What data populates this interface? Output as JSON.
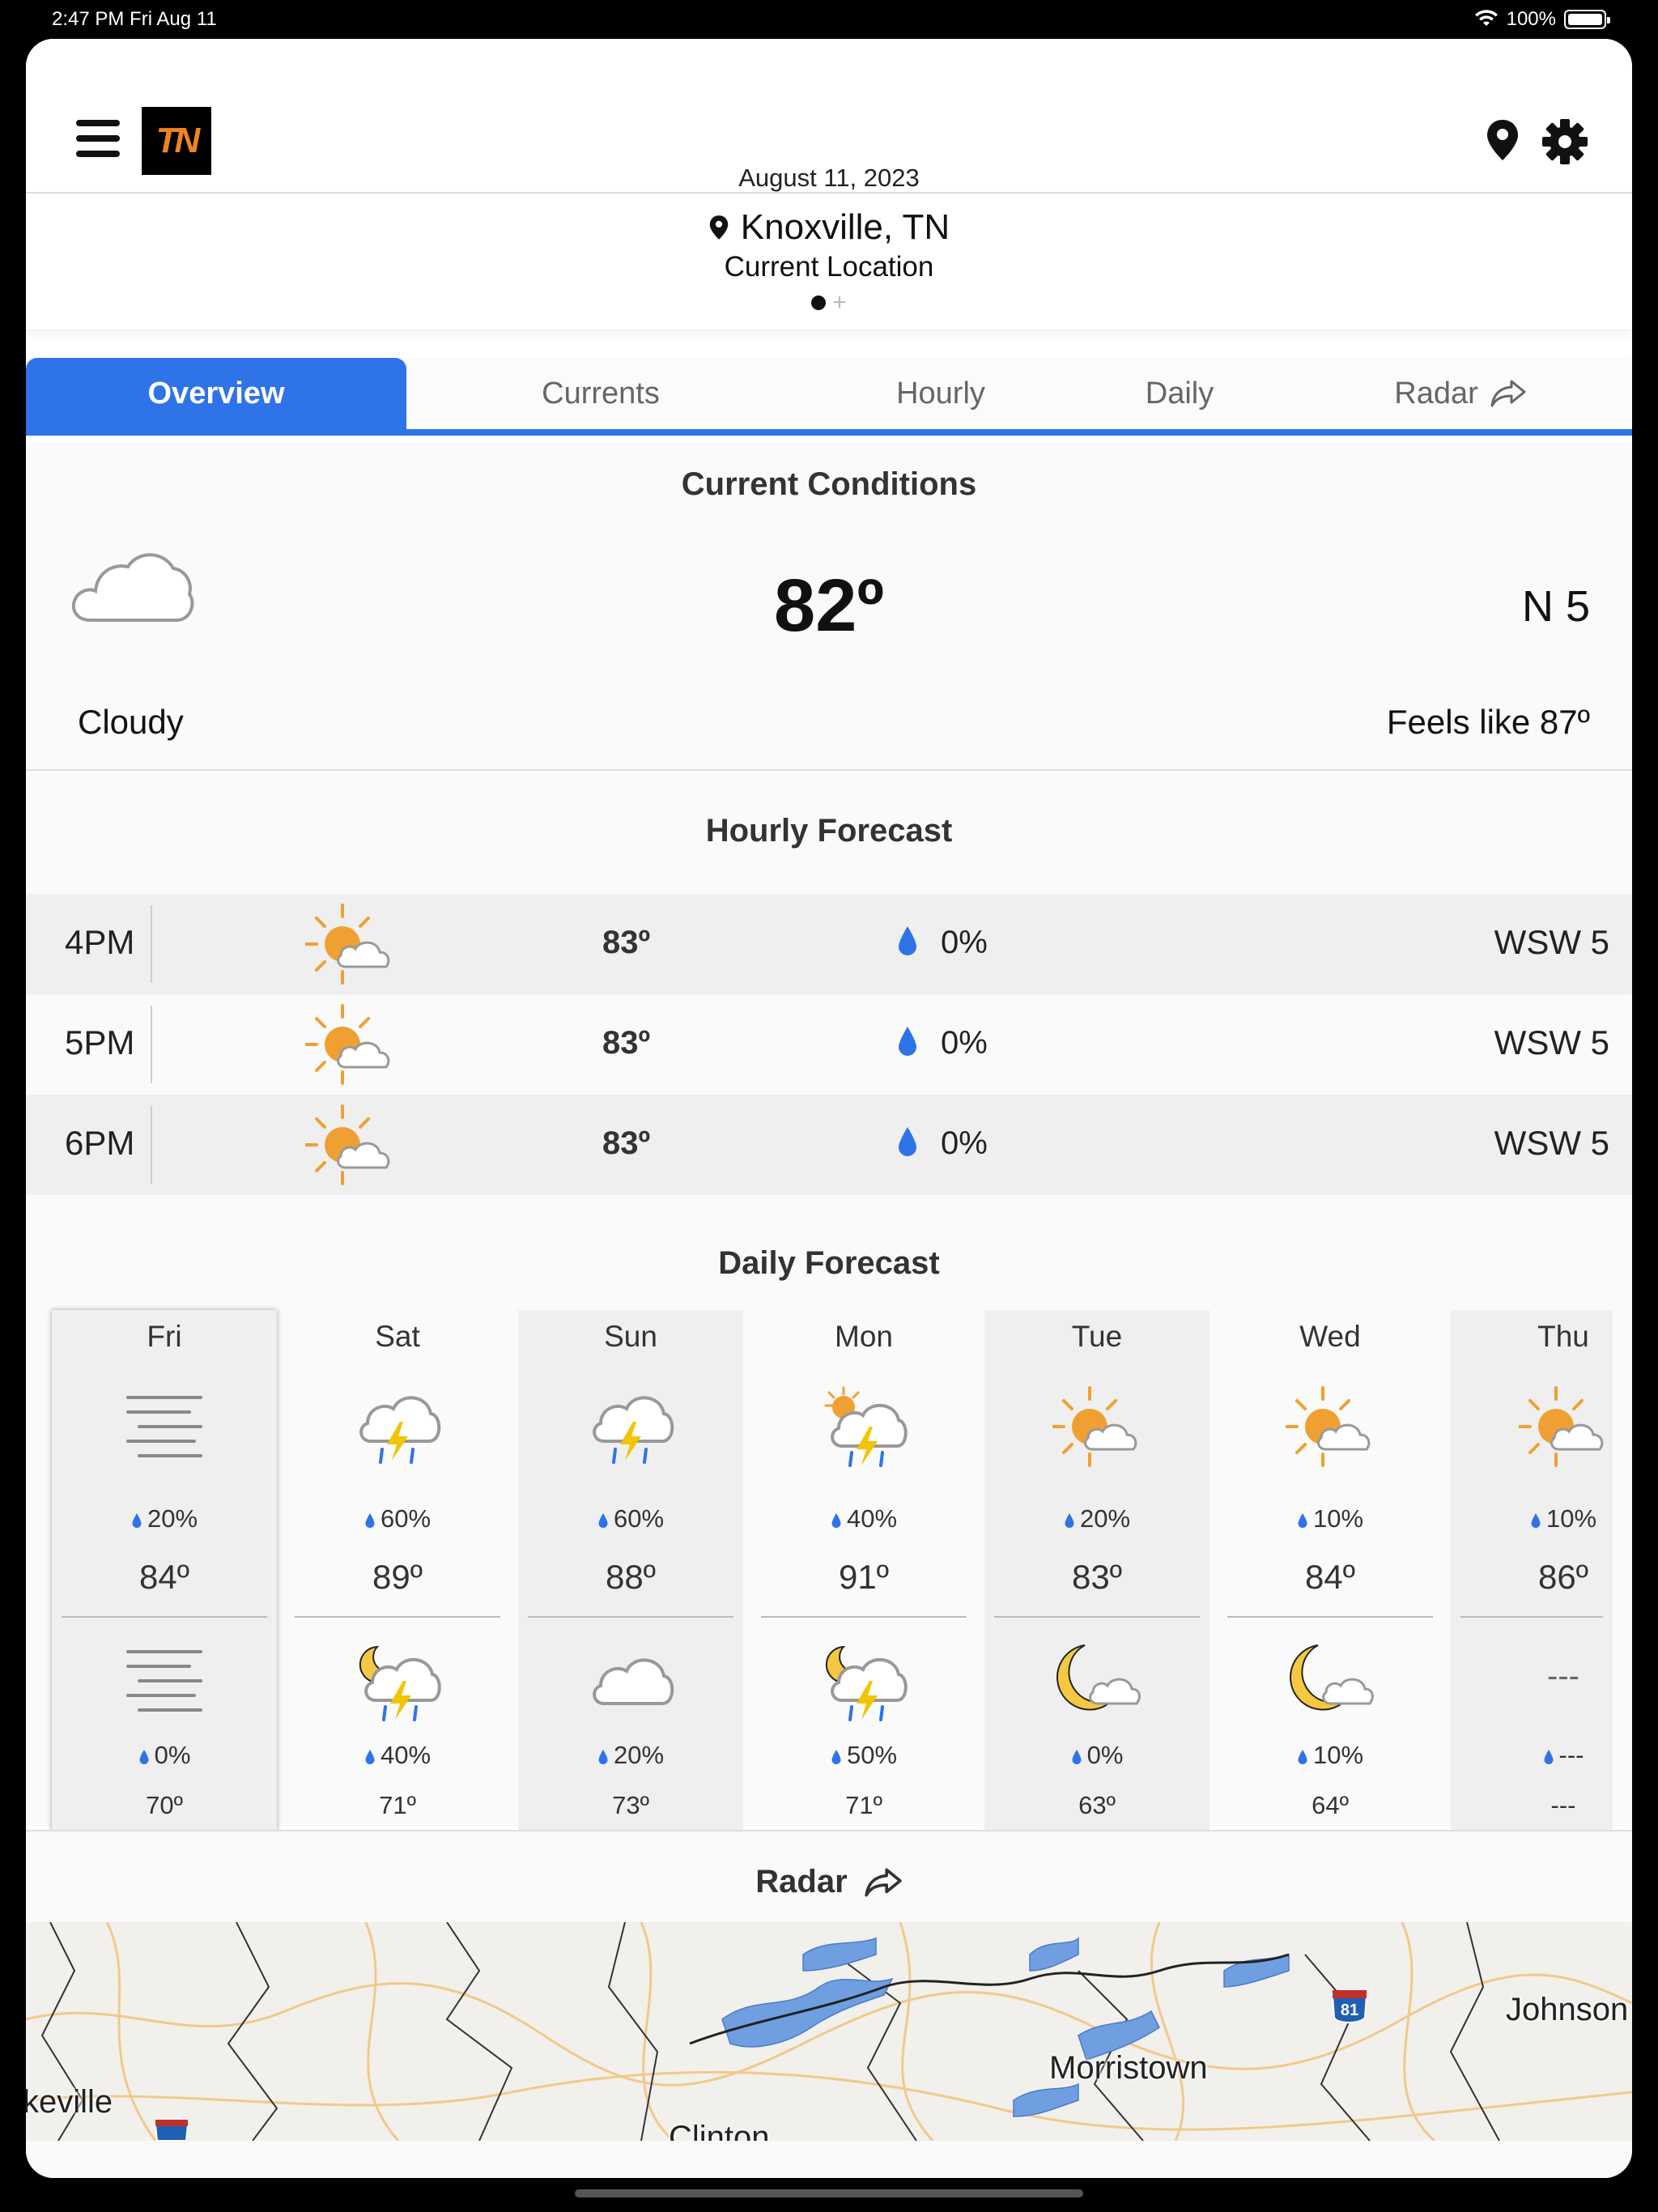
{
  "status_bar": {
    "time": "2:47 PM   Fri Aug 11",
    "battery": "100%"
  },
  "header": {
    "date": "August 11, 2023",
    "logo_text": "TN"
  },
  "location": {
    "name": "Knoxville, TN",
    "subtitle": "Current Location"
  },
  "tabs": [
    {
      "label": "Overview",
      "active": true
    },
    {
      "label": "Currents",
      "active": false
    },
    {
      "label": "Hourly",
      "active": false
    },
    {
      "label": "Daily",
      "active": false
    },
    {
      "label": "Radar",
      "active": false
    }
  ],
  "current_conditions": {
    "title": "Current Conditions",
    "temperature": "82º",
    "wind": "N 5",
    "condition": "Cloudy",
    "feels_like": "Feels like 87º",
    "icon": "cloud-icon"
  },
  "hourly_forecast": {
    "title": "Hourly Forecast",
    "rows": [
      {
        "time": "4PM",
        "temp": "83º",
        "precip": "0%",
        "wind": "WSW 5",
        "icon": "partly-sunny-icon"
      },
      {
        "time": "5PM",
        "temp": "83º",
        "precip": "0%",
        "wind": "WSW 5",
        "icon": "partly-sunny-icon"
      },
      {
        "time": "6PM",
        "temp": "83º",
        "precip": "0%",
        "wind": "WSW 5",
        "icon": "partly-sunny-icon"
      }
    ]
  },
  "daily_forecast": {
    "title": "Daily Forecast",
    "days": [
      {
        "day": "Fri",
        "day_icon": "fog-icon",
        "day_precip": "20%",
        "high": "84º",
        "night_icon": "fog-icon",
        "night_precip": "0%",
        "low": "70º"
      },
      {
        "day": "Sat",
        "day_icon": "thunderstorm-icon",
        "day_precip": "60%",
        "high": "89º",
        "night_icon": "night-thunderstorm-icon",
        "night_precip": "40%",
        "low": "71º"
      },
      {
        "day": "Sun",
        "day_icon": "thunderstorm-icon",
        "day_precip": "60%",
        "high": "88º",
        "night_icon": "cloud-icon",
        "night_precip": "20%",
        "low": "73º"
      },
      {
        "day": "Mon",
        "day_icon": "sun-thunderstorm-icon",
        "day_precip": "40%",
        "high": "91º",
        "night_icon": "night-thunderstorm-icon",
        "night_precip": "50%",
        "low": "71º"
      },
      {
        "day": "Tue",
        "day_icon": "partly-sunny-icon",
        "day_precip": "20%",
        "high": "83º",
        "night_icon": "partly-cloudy-night-icon",
        "night_precip": "0%",
        "low": "63º"
      },
      {
        "day": "Wed",
        "day_icon": "partly-sunny-icon",
        "day_precip": "10%",
        "high": "84º",
        "night_icon": "partly-cloudy-night-icon",
        "night_precip": "10%",
        "low": "64º"
      },
      {
        "day": "Thu",
        "day_icon": "partly-sunny-icon",
        "day_precip": "10%",
        "high": "86º",
        "night_icon": "none",
        "night_placeholder": "---",
        "night_precip": "---",
        "low": "---"
      }
    ]
  },
  "radar": {
    "title": "Radar",
    "map_labels": [
      "Morristown",
      "Johnson",
      "keville",
      "Clinton"
    ],
    "highway_shield": "81"
  },
  "colors": {
    "accent": "#2f73e8",
    "sun": "#f0a032",
    "moon": "#f5c842",
    "rain": "#2f73e8",
    "bolt": "#f2c500"
  }
}
